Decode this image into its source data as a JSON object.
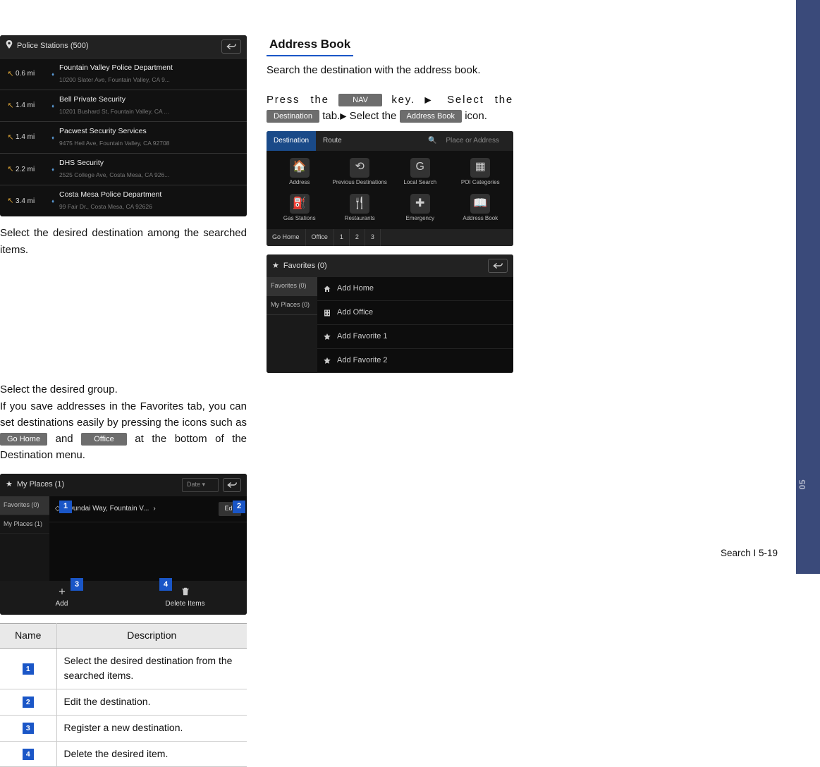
{
  "col1": {
    "ss_header": "Police Stations (500)",
    "rows": [
      {
        "dist": "0.6 mi",
        "name": "Fountain Valley Police Department",
        "addr": "10200 Slater Ave, Fountain Valley, CA 9..."
      },
      {
        "dist": "1.4 mi",
        "name": "Bell Private Security",
        "addr": "10201 Bushard St, Fountain Valley, CA ..."
      },
      {
        "dist": "1.4 mi",
        "name": "Pacwest Security Services",
        "addr": "9475 Heil Ave, Fountain Valley, CA 92708"
      },
      {
        "dist": "2.2 mi",
        "name": "DHS Security",
        "addr": "2525 College Ave, Costa Mesa, CA 926..."
      },
      {
        "dist": "3.4 mi",
        "name": "Costa Mesa Police Department",
        "addr": "99 Fair Dr., Costa Mesa, CA 92626"
      }
    ],
    "caption": "Select the desired destination among the searched items."
  },
  "col2": {
    "heading": "Address Book",
    "intro": "Search the destination with the address book.",
    "step_press": "Press the",
    "btn_nav": "NAV",
    "step_key": "key.",
    "step_select": "Select the",
    "btn_dest": "Destination",
    "step_tab": "tab.",
    "btn_ab": "Address Book",
    "step_icon": "icon.",
    "dest_tabs": {
      "active": "Destination",
      "other": "Route",
      "search_hint": "Place or Address"
    },
    "dest_cells": [
      "Address",
      "Previous Destinations",
      "Local Search",
      "POI Categories",
      "Gas Stations",
      "Restaurants",
      "Emergency",
      "Address Book"
    ],
    "dest_foot": [
      "Go Home",
      "Office",
      "1",
      "2",
      "3"
    ],
    "fav_header": "Favorites (0)",
    "fav_side": [
      {
        "t": "Favorites (0)",
        "active": true
      },
      {
        "t": "My Places (0)"
      }
    ],
    "fav_items": [
      "Add Home",
      "Add Office",
      "Add Favorite 1",
      "Add Favorite 2"
    ]
  },
  "col3": {
    "para1": "Select the desired group.",
    "para2a": "If you save addresses in the Favorites tab, you can set destinations easily by pressing the icons such as",
    "btn_gohome": "Go Home",
    "para2b": "and",
    "btn_office": "Office",
    "para2c": "at the bottom of the Destination menu.",
    "ss_header": "My Places (1)",
    "ss_sort": "Date",
    "ss_side": [
      {
        "t": "Favorites (0)",
        "active": true
      },
      {
        "t": "My Places (1)"
      }
    ],
    "ss_item_name": "Hyundai Way, Fountain V...",
    "ss_edit": "Edit",
    "ss_foot_add": "Add",
    "ss_foot_del": "Delete Items",
    "callouts": {
      "c1": "1",
      "c2": "2",
      "c3": "3",
      "c4": "4"
    },
    "table_headers": {
      "name": "Name",
      "desc": "Description"
    },
    "table_rows": [
      {
        "n": "1",
        "d": "Select the desired destination from the searched items."
      },
      {
        "n": "2",
        "d": "Edit the destination."
      },
      {
        "n": "3",
        "d": "Register a new destination."
      },
      {
        "n": "4",
        "d": "Delete the desired item."
      }
    ]
  },
  "footer": "Search I 5-19",
  "chapter_tab": "05"
}
